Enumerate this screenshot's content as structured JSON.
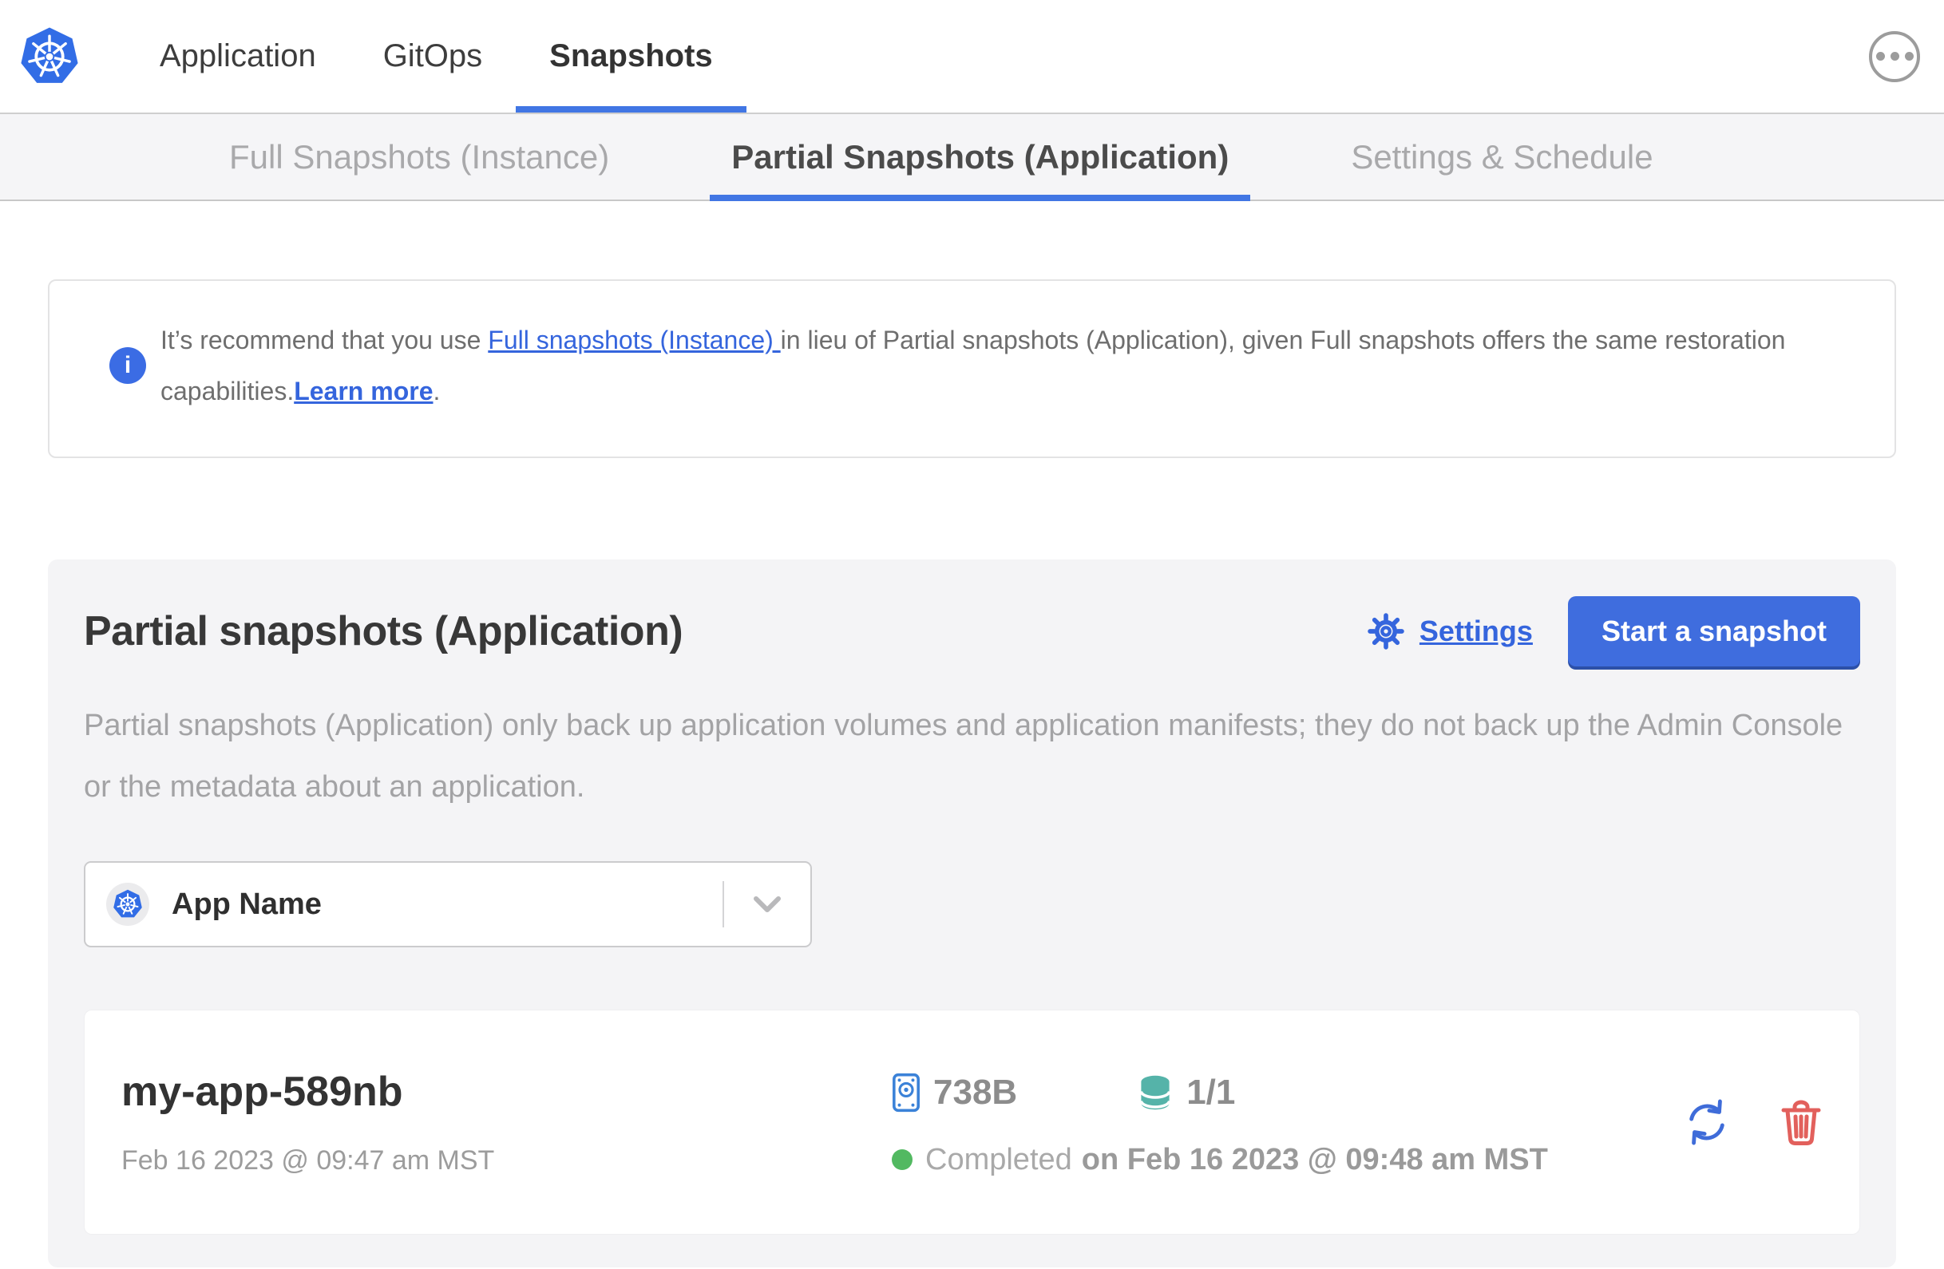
{
  "topnav": {
    "items": [
      {
        "label": "Application",
        "active": false
      },
      {
        "label": "GitOps",
        "active": false
      },
      {
        "label": "Snapshots",
        "active": true
      }
    ]
  },
  "subnav": {
    "items": [
      {
        "label": "Full Snapshots (Instance)",
        "active": false
      },
      {
        "label": "Partial Snapshots (Application)",
        "active": true
      },
      {
        "label": "Settings & Schedule",
        "active": false
      }
    ]
  },
  "banner": {
    "text_before_link": "It’s recommend that you use ",
    "instance_link": "Full snapshots (Instance) ",
    "text_middle": "in lieu of Partial snapshots (Application), given Full snapshots offers the same restoration capabilities.",
    "learn_more_link": "Learn more",
    "text_after": "."
  },
  "panel": {
    "title": "Partial snapshots (Application)",
    "settings_label": "Settings",
    "start_snapshot_label": "Start a snapshot",
    "description": "Partial snapshots (Application) only back up application volumes and application manifests; they do not back up the Admin Console or the metadata about an application.",
    "app_selector_value": "App Name"
  },
  "snapshot": {
    "name": "my-app-589nb",
    "started_at": "Feb 16 2023 @ 09:47 am MST",
    "size": "738B",
    "volumes": "1/1",
    "status": "Completed",
    "completed_at": "on Feb 16 2023 @ 09:48 am MST"
  },
  "icons": {
    "kubernetes-logo": "blue heptagon with white helm wheel",
    "more-icon": "ellipsis in circle",
    "info-icon": "i",
    "gear-icon": "settings gear outline",
    "chevron-down-icon": "v",
    "disk-icon": "hard drive outline",
    "volumes-icon": "database cylinder",
    "restore-icon": "circular arrows",
    "delete-icon": "trash can"
  },
  "colors": {
    "accent_blue": "#3b6cdb",
    "kubernetes_blue": "#326de6",
    "teal": "#55b3a9",
    "danger_red": "#e2605c",
    "success_green": "#52b961"
  }
}
